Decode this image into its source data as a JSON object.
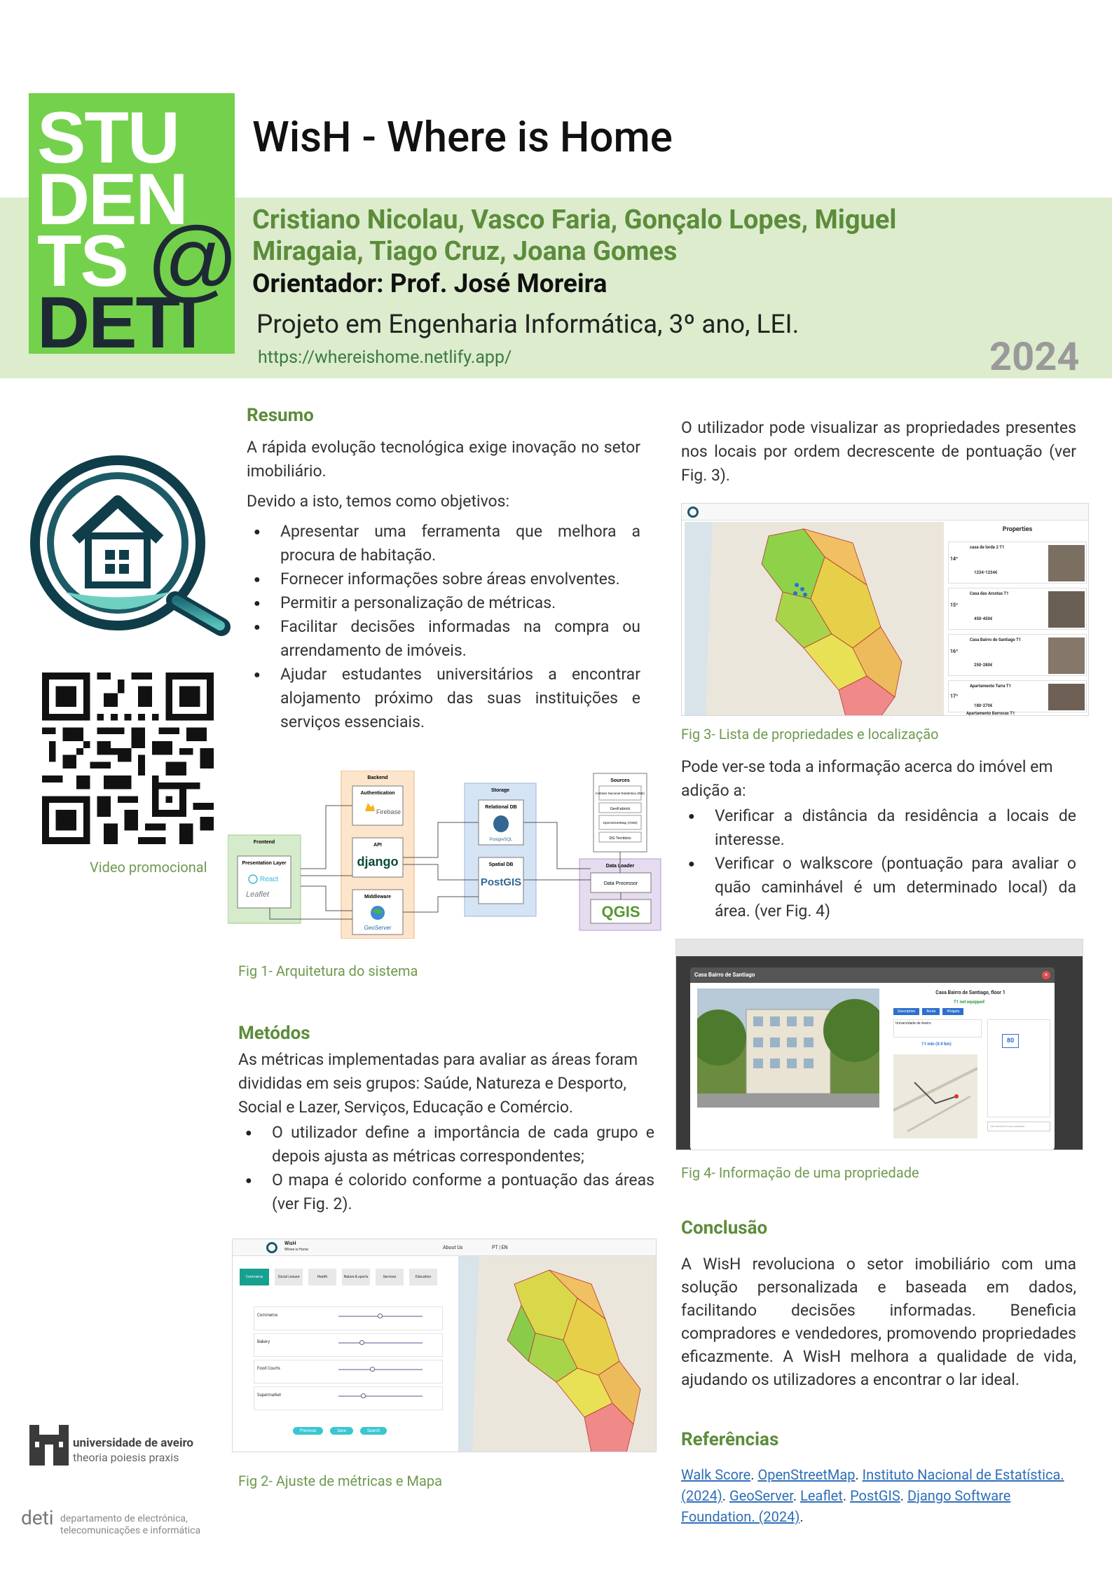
{
  "header": {
    "logo": {
      "line1": "STU",
      "line2": "DEN",
      "line3": "TS",
      "line4": "DETI",
      "at": "@"
    },
    "title": "WisH - Where is Home",
    "authors": "Cristiano Nicolau, Vasco Faria, Gonçalo Lopes, Miguel Miragaia, Tiago Cruz, Joana Gomes",
    "advisor": "Orientador: Prof. José Moreira",
    "course": "Projeto em Engenharia Informática, 3º ano, LEI.",
    "url": "https://whereishome.netlify.app/",
    "year": "2024"
  },
  "left": {
    "qr_caption": "Video promocional",
    "university_name": "universidade de aveiro",
    "university_motto": "theoria poiesis praxis",
    "deti_short": "deti",
    "deti_name_line1": "departamento de electrónica,",
    "deti_name_line2": "telecomunicações e informática"
  },
  "resumo": {
    "heading": "Resumo",
    "p1": "A rápida evolução tecnológica exige inovação no setor imobiliário.",
    "p2": "Devido a isto, temos como objetivos:",
    "items": [
      "Apresentar uma ferramenta que melhora a procura de habitação.",
      "Fornecer informações sobre áreas envolventes.",
      "Permitir a personalização de métricas.",
      "Facilitar decisões informadas na compra ou arrendamento de imóveis.",
      "Ajudar estudantes universitários a encontrar alojamento próximo das suas instituições e serviços essenciais."
    ]
  },
  "fig1": {
    "caption": "Fig 1- Arquitetura do sistema",
    "frontend": "Frontend",
    "presentation": "Presentation Layer",
    "react": "React",
    "leaflet": "Leaflet",
    "backend": "Backend",
    "auth": "Authentication",
    "firebase": "Firebase",
    "api": "API",
    "django": "django",
    "middleware": "Middleware",
    "geoserver": "GeoServer",
    "storage": "Storage",
    "relational": "Relational DB",
    "postgres": "PostgreSQL",
    "spatial": "Spatial DB",
    "postgis": "PostGIS",
    "sources": "Sources",
    "src1": "Instituto Nacional Estatística (INE)",
    "src2": "GeoFabrick",
    "src3": "OpenStreetMap (OSM)",
    "src4": "DG Território",
    "loader": "Data Loader",
    "processor": "Data Processor",
    "qgis": "QGIS"
  },
  "metodos": {
    "heading": "Metódos",
    "p1": "As métricas implementadas para avaliar as áreas foram divididas em seis grupos: Saúde, Natureza e Desporto, Social e Lazer, Serviços, Educação e Comércio.",
    "items": [
      "O utilizador define a importância de cada grupo e depois ajusta as métricas correspondentes;",
      "O mapa é colorido conforme a pontuação das áreas (ver Fig. 2)."
    ]
  },
  "fig2": {
    "caption": "Fig 2- Ajuste de métricas e Mapa",
    "app_name": "WisH",
    "app_sub": "Where is Home",
    "about": "About Us",
    "lang": "PT | EN",
    "tabs": [
      "Commerce",
      "Social Leisure",
      "Health",
      "Nature & sports",
      "Services",
      "Education"
    ],
    "metrics": [
      "Commerce",
      "Bakery",
      "Food Courts",
      "Supermarket"
    ],
    "buttons": [
      "Previous",
      "Save",
      "Search"
    ]
  },
  "right": {
    "p_top": "O utilizador pode visualizar as propriedades presentes nos locais por ordem decrescente de pontuação (ver Fig. 3).",
    "p_mid": "Pode ver-se toda a informação acerca do imóvel em adição a:",
    "items": [
      "Verificar a distância da residência a locais de interesse.",
      "Verificar o walkscore (pontuação para avaliar o quão caminhável é um determinado local) da área. (ver Fig. 4)"
    ]
  },
  "fig3": {
    "caption": "Fig 3- Lista de propriedades e localização",
    "panel_title": "Properties",
    "cards": [
      {
        "rank": "14º",
        "name": "casa de lorde 2 T1",
        "price": "1234-1234€"
      },
      {
        "rank": "15º",
        "name": "Casa das Arcotas T1",
        "price": "450-450€"
      },
      {
        "rank": "16º",
        "name": "Casa Bairro de Santiago T1",
        "price": "250-280€"
      },
      {
        "rank": "17º",
        "name": "Apartamento Tarra T1",
        "price": "180-270€"
      }
    ],
    "last_card": "Apartamento Barrocas T1"
  },
  "fig4": {
    "caption": "Fig 4- Informação de uma propriedade",
    "modal_title": "Casa Bairro de Santiago",
    "subtitle": "Casa Bairro de Santiago, floor 1",
    "status": "T1 not equipped",
    "tabs": [
      "Description",
      "Route",
      "Widgets"
    ],
    "uni": "Universidade de Aveiro",
    "time": "11 min (0.9 km)",
    "walkscore": "80",
    "search_placeholder": "Get scores for your address"
  },
  "conclusao": {
    "heading": "Conclusão",
    "text": "A WisH revoluciona o setor imobiliário com uma solução personalizada e baseada em dados, facilitando decisões informadas. Beneficia compradores e vendedores, promovendo propriedades eficazmente. A WisH melhora a qualidade de vida, ajudando os utilizadores a encontrar o lar ideal."
  },
  "referencias": {
    "heading": "Referências",
    "links": [
      "Walk Score",
      "OpenStreetMap",
      "Instituto Nacional de Estatística. (2024)",
      "GeoServer",
      "Leaflet",
      "PostGIS",
      "Django Software Foundation. (2024)"
    ]
  },
  "colors": {
    "green_dark": "#5c8c3a",
    "band": "#dceccd",
    "logo": "#74d14c",
    "link": "#2f6fb8"
  }
}
